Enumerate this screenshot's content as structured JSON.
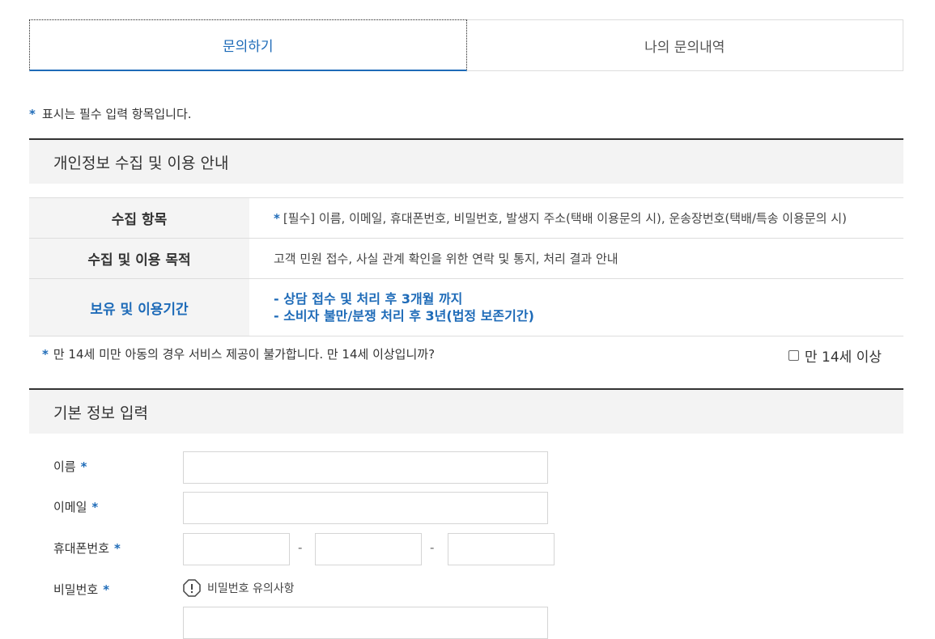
{
  "tabs": [
    {
      "label": "문의하기",
      "active": true
    },
    {
      "label": "나의 문의내역",
      "active": false
    }
  ],
  "required_mark": "*",
  "required_note": "표시는 필수 입력 항목입니다.",
  "privacy_section": {
    "title": "개인정보 수집 및 이용 안내",
    "rows": [
      {
        "header": "수집 항목",
        "value": "[필수] 이름, 이메일, 휴대폰번호, 비밀번호, 발생지 주소(택배 이용문의 시), 운송장번호(택배/특송 이용문의 시)"
      },
      {
        "header": "수집 및 이용 목적",
        "value": "고객 민원 접수, 사실 관계 확인을 위한 연락 및 통지, 처리 결과 안내"
      },
      {
        "header": "보유 및 이용기간",
        "lines": [
          "- 상담 접수 및 처리 후 3개월 까지",
          "- 소비자 불만/분쟁 처리 후 3년(법정 보존기간)"
        ]
      }
    ]
  },
  "age_notice": "만 14세 미만 아동의 경우 서비스 제공이 불가합니다. 만 14세 이상입니까?",
  "age_checkbox_label": "만 14세 이상",
  "basic_section": {
    "title": "기본 정보 입력",
    "fields": {
      "name": "이름",
      "email": "이메일",
      "phone": "휴대폰번호",
      "password": "비밀번호"
    },
    "phone_separator": "-",
    "password_hint": "비밀번호 유의사항"
  },
  "colors": {
    "accent": "#1e6bb8",
    "header_bg": "#f3f3f3"
  }
}
